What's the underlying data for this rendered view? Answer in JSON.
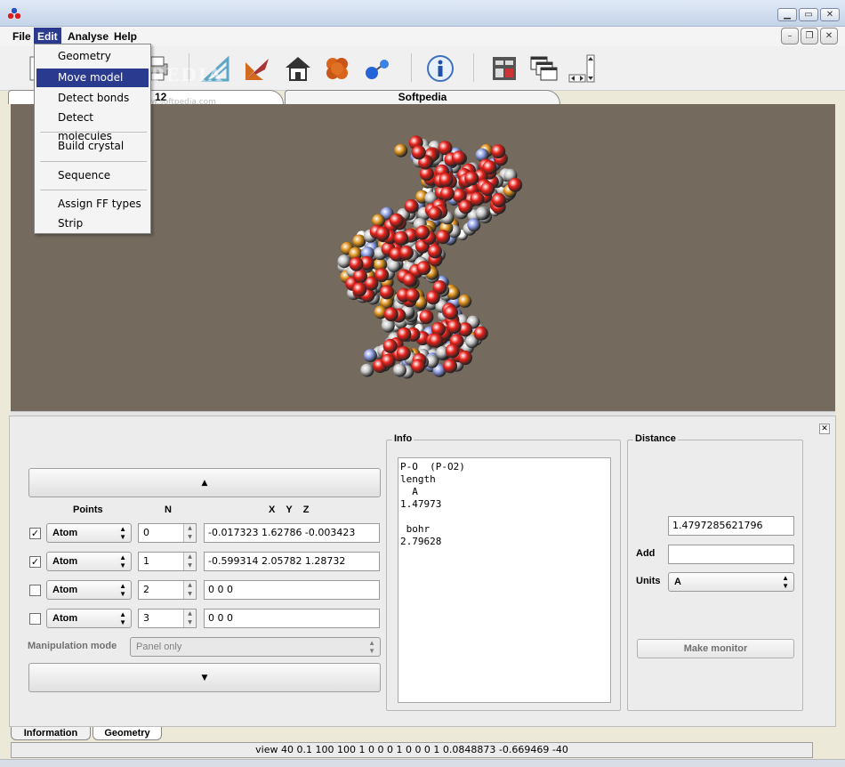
{
  "app": {
    "icon": "molecule-app-icon"
  },
  "menubar": {
    "items": [
      "File",
      "Edit",
      "Analyse",
      "Help"
    ],
    "active": "Edit"
  },
  "edit_menu": {
    "items": [
      "Geometry",
      "Move model",
      "Detect bonds",
      "Detect molecules",
      "Build crystal",
      "Sequence",
      "Assign FF types",
      "Strip"
    ],
    "highlighted": "Move model"
  },
  "toolbar": {
    "icons": [
      "new-icon",
      "open-icon",
      "print-icon",
      "unit-cell-icon",
      "axes-icon",
      "home-icon",
      "space-fill-icon",
      "ball-stick-icon",
      "info-icon",
      "panel-layout-icon",
      "window-cascade-icon",
      "scroll-icon"
    ]
  },
  "tabs": {
    "first_label": "12",
    "second_label": "Softpedia"
  },
  "watermark": {
    "text": "SOFTPEDIA",
    "url": "www.softpedia.com"
  },
  "geometry_panel": {
    "col_points": "Points",
    "col_n": "N",
    "col_xyz": "X    Y    Z",
    "up_arrow": "▲",
    "down_arrow": "▼",
    "rows": [
      {
        "checked": "✓",
        "type": "Atom",
        "n": "0",
        "coords": "-0.017323 1.62786 -0.003423"
      },
      {
        "checked": "✓",
        "type": "Atom",
        "n": "1",
        "coords": "-0.599314 2.05782 1.28732"
      },
      {
        "checked": "",
        "type": "Atom",
        "n": "2",
        "coords": "0 0 0"
      },
      {
        "checked": "",
        "type": "Atom",
        "n": "3",
        "coords": "0 0 0"
      }
    ],
    "manip_label": "Manipulation mode",
    "manip_value": "Panel only"
  },
  "info": {
    "title": "Info",
    "text": "P-O  (P-O2)\nlength\n  A\n1.47973\n\n bohr\n2.79628"
  },
  "distance": {
    "title": "Distance",
    "value": "1.4797285621796",
    "add_label": "Add",
    "add_value": "",
    "units_label": "Units",
    "units_value": "A",
    "make_monitor": "Make monitor"
  },
  "bottom_tabs": [
    "Information",
    "Geometry"
  ],
  "status": "view 40 0.1 100 100 1 0 0 0 1 0 0 0 1 0.0848873 -0.669469 -40",
  "colors": {
    "viewport_bg": "#746a5e",
    "menu_highlight": "#2a3a8e",
    "oxygen": "#e8211a",
    "carbon": "#c8c8c8",
    "nitrogen": "#8f9fe6",
    "phosphorus": "#e0941f"
  }
}
